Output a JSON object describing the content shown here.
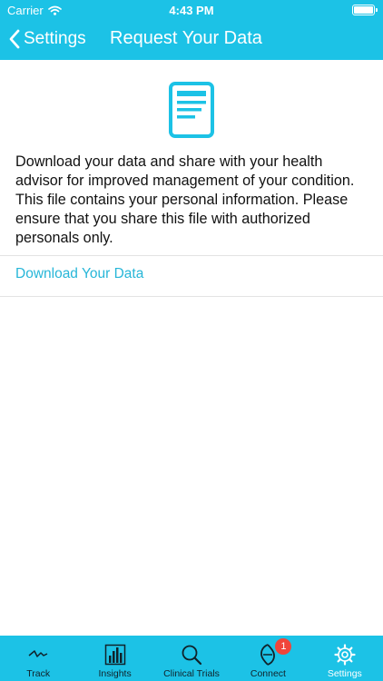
{
  "status_bar": {
    "carrier": "Carrier",
    "time": "4:43 PM"
  },
  "nav": {
    "back_label": "Settings",
    "title": "Request Your Data"
  },
  "content": {
    "description": "Download your data and share with your health advisor for improved management of your condition. This file contains your personal information. Please ensure that you share this file with authorized personals only.",
    "download_label": "Download Your Data"
  },
  "tabs": [
    {
      "label": "Track",
      "icon": "pulse-icon"
    },
    {
      "label": "Insights",
      "icon": "bar-chart-icon"
    },
    {
      "label": "Clinical Trials",
      "icon": "magnifier-icon"
    },
    {
      "label": "Connect",
      "icon": "connect-icon",
      "badge": "1"
    },
    {
      "label": "Settings",
      "icon": "gear-icon",
      "active": true
    }
  ],
  "colors": {
    "accent": "#1cc2e6",
    "link": "#27b6d8",
    "badge": "#f0453a"
  }
}
